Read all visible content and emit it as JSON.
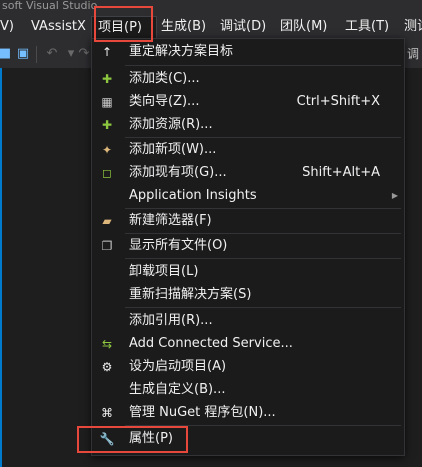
{
  "window": {
    "title_fragment": "soft Visual Studio"
  },
  "menubar": {
    "items": [
      {
        "label": "V)"
      },
      {
        "label": "VAssistX"
      },
      {
        "label": "项目(P)"
      },
      {
        "label": "生成(B)"
      },
      {
        "label": "调试(D)"
      },
      {
        "label": "团队(M)"
      },
      {
        "label": "工具(T)"
      },
      {
        "label": "测试"
      }
    ]
  },
  "toolbar": {
    "tail_text": "s 调"
  },
  "project_menu": {
    "items": [
      {
        "label": "重定解决方案目标",
        "shortcut": "",
        "icon": "up-arrow-icon"
      },
      {
        "label": "添加类(C)...",
        "shortcut": "",
        "icon": "add-class-icon"
      },
      {
        "label": "类向导(Z)...",
        "shortcut": "Ctrl+Shift+X",
        "icon": "class-wizard-icon"
      },
      {
        "label": "添加资源(R)...",
        "shortcut": "",
        "icon": "add-resource-icon"
      },
      {
        "label": "添加新项(W)...",
        "shortcut": "",
        "icon": "add-new-item-icon"
      },
      {
        "label": "添加现有项(G)...",
        "shortcut": "Shift+Alt+A",
        "icon": "add-existing-item-icon"
      },
      {
        "label": "Application Insights",
        "shortcut": "",
        "icon": "",
        "submenu": true
      },
      {
        "label": "新建筛选器(F)",
        "shortcut": "",
        "icon": "new-filter-folder-icon"
      },
      {
        "label": "显示所有文件(O)",
        "shortcut": "",
        "icon": "show-all-files-icon"
      },
      {
        "label": "卸载项目(L)",
        "shortcut": "",
        "icon": ""
      },
      {
        "label": "重新扫描解决方案(S)",
        "shortcut": "",
        "icon": ""
      },
      {
        "label": "添加引用(R)...",
        "shortcut": "",
        "icon": ""
      },
      {
        "label": "Add Connected Service...",
        "shortcut": "",
        "icon": "connected-service-icon"
      },
      {
        "label": "设为启动项目(A)",
        "shortcut": "",
        "icon": "gear-icon"
      },
      {
        "label": "生成自定义(B)...",
        "shortcut": "",
        "icon": ""
      },
      {
        "label": "管理 NuGet 程序包(N)...",
        "shortcut": "",
        "icon": "nuget-package-icon"
      },
      {
        "label": "属性(P)",
        "shortcut": "",
        "icon": "wrench-icon"
      }
    ]
  },
  "colors": {
    "background": "#1e1e1e",
    "chrome": "#2d2d30",
    "menu_background": "#1b1b1c",
    "menu_border": "#333337",
    "text": "#f1f1f1",
    "highlight_box": "#e8473b",
    "accent": "#007acc"
  }
}
